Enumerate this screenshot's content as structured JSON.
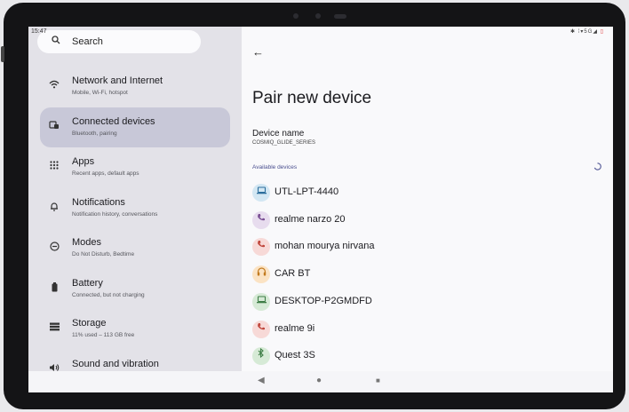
{
  "status_bar": {
    "time": "15:47",
    "icons": "✱ ⁞▾5G◢",
    "battery_icon": "battery-low-icon"
  },
  "search": {
    "icon": "search-icon",
    "label": "Search"
  },
  "sidebar": {
    "items": [
      {
        "title": "Network and Internet",
        "subtitle": "Mobile, Wi-Fi, hotspot",
        "icon": "wifi-icon",
        "selected": false
      },
      {
        "title": "Connected devices",
        "subtitle": "Bluetooth, pairing",
        "icon": "connected-devices-icon",
        "selected": true
      },
      {
        "title": "Apps",
        "subtitle": "Recent apps, default apps",
        "icon": "apps-grid-icon",
        "selected": false
      },
      {
        "title": "Notifications",
        "subtitle": "Notification history, conversations",
        "icon": "bell-icon",
        "selected": false
      },
      {
        "title": "Modes",
        "subtitle": "Do Not Disturb, Bedtime",
        "icon": "modes-icon",
        "selected": false
      },
      {
        "title": "Battery",
        "subtitle": "Connected, but not charging",
        "icon": "battery-icon",
        "selected": false
      },
      {
        "title": "Storage",
        "subtitle": "11% used – 113 GB free",
        "icon": "storage-icon",
        "selected": false
      },
      {
        "title": "Sound and vibration",
        "subtitle": "Volume and vibration",
        "icon": "speaker-icon",
        "selected": false
      }
    ]
  },
  "main": {
    "back_icon": "back-arrow-icon",
    "title": "Pair new device",
    "device_name_label": "Device name",
    "device_name_value": "COSMIQ_GLIDE_SERIES",
    "available_label": "Available devices",
    "spinner_icon": "loading-spinner-icon",
    "devices": [
      {
        "name": "UTL-LPT-4440",
        "icon": "laptop-icon",
        "color": "#d3e7f3",
        "glyph_color": "#2b6d9c"
      },
      {
        "name": "realme narzo 20",
        "icon": "phone-icon",
        "color": "#e7dcee",
        "glyph_color": "#7a4f94"
      },
      {
        "name": "mohan mourya nirvana",
        "icon": "phone-icon",
        "color": "#f7d9d7",
        "glyph_color": "#c0473d"
      },
      {
        "name": "CAR BT",
        "icon": "headphones-icon",
        "color": "#fbe3c4",
        "glyph_color": "#c27a1e"
      },
      {
        "name": "DESKTOP-P2GMDFD",
        "icon": "laptop-icon",
        "color": "#d6ead6",
        "glyph_color": "#3d7d45"
      },
      {
        "name": "realme 9i",
        "icon": "phone-icon",
        "color": "#f7d9d7",
        "glyph_color": "#c0473d"
      },
      {
        "name": "Quest 3S",
        "icon": "bluetooth-icon",
        "color": "#d6ead6",
        "glyph_color": "#3d7d45"
      }
    ]
  },
  "nav_bar": {
    "back": "back-nav-icon",
    "home": "home-nav-icon",
    "recents": "recents-nav-icon"
  }
}
